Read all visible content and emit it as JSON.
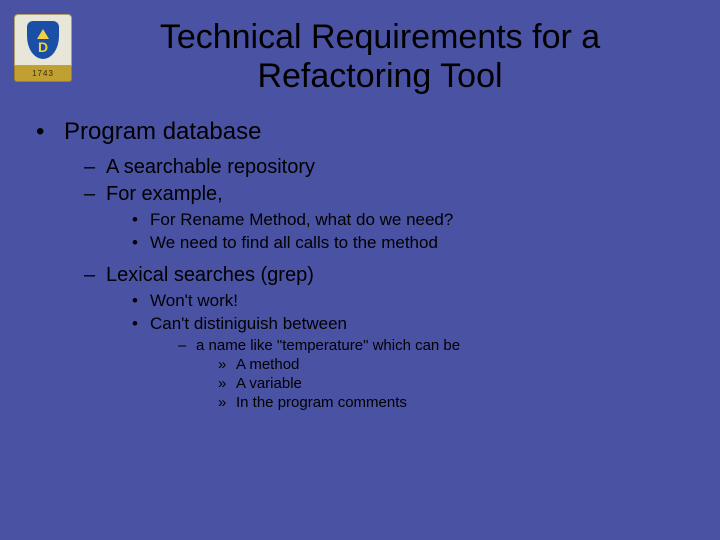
{
  "logo": {
    "year": "1743"
  },
  "title": "Technical Requirements for a Refactoring Tool",
  "b1": "Program database",
  "b1_1": "A searchable repository",
  "b1_2": "For example,",
  "b1_2_1": "For Rename Method, what do we need?",
  "b1_2_2": "We need to find all calls to the method",
  "b1_3": "Lexical searches (grep)",
  "b1_3_1": "Won't work!",
  "b1_3_2": "Can't distiniguish between",
  "b1_3_2_1": "a name like \"temperature\" which can be",
  "b1_3_2_1_1": "A method",
  "b1_3_2_1_2": "A variable",
  "b1_3_2_1_3": "In the program comments"
}
